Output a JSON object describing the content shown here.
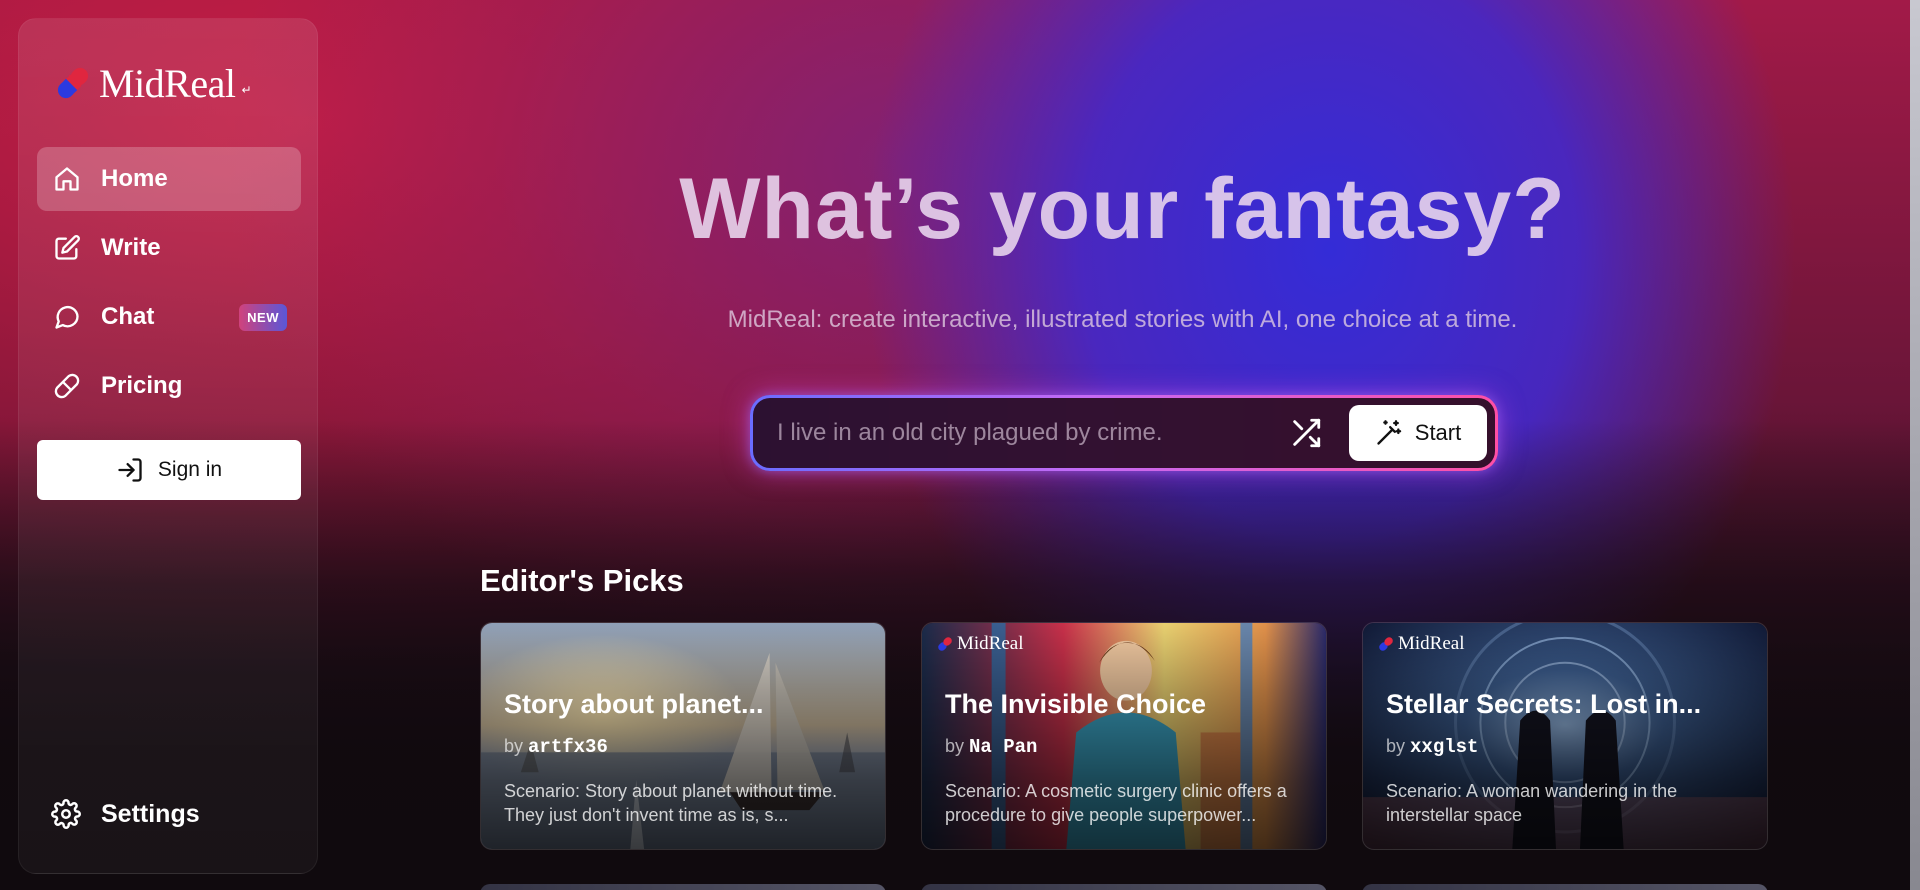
{
  "brand": {
    "name": "MidReal",
    "superscript": "↵"
  },
  "sidebar": {
    "items": [
      {
        "label": "Home",
        "icon": "home-icon",
        "active": true
      },
      {
        "label": "Write",
        "icon": "edit-icon"
      },
      {
        "label": "Chat",
        "icon": "chat-bubble-icon",
        "badge": "NEW"
      },
      {
        "label": "Pricing",
        "icon": "pill-icon"
      }
    ],
    "sign_in_label": "Sign in",
    "settings_label": "Settings"
  },
  "hero": {
    "title": "What’s your fantasy?",
    "subtitle": "MidReal: create interactive, illustrated stories with AI, one choice at a time.",
    "input_placeholder": "I live in an old city plagued by crime.",
    "start_label": "Start"
  },
  "editors_picks": {
    "title": "Editor's Picks",
    "by_label": "by",
    "cards": [
      {
        "title": "Story about planet...",
        "author": "artfx36",
        "description": "Scenario: Story about planet without time. They just don't invent time as is, s...",
        "show_brand": false
      },
      {
        "title": "The Invisible Choice",
        "author": "Na Pan",
        "description": "Scenario: A cosmetic surgery clinic offers a procedure to give people superpower...",
        "show_brand": true
      },
      {
        "title": "Stellar Secrets: Lost in...",
        "author": "xxglst",
        "description": "Scenario: A woman wandering in the interstellar space",
        "show_brand": true
      }
    ]
  },
  "colors": {
    "accent_pink": "#ff4fa6",
    "accent_blue": "#6a6cff",
    "logo_red": "#e0263f",
    "logo_blue": "#2b3ae0"
  }
}
